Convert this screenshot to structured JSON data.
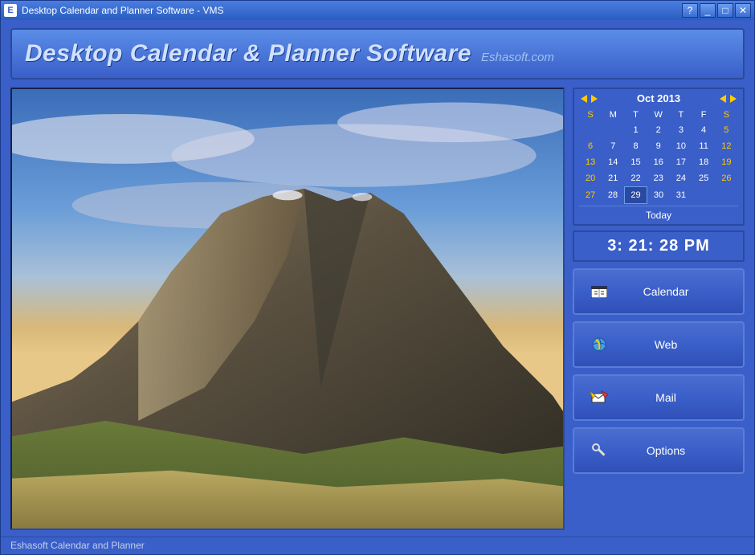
{
  "window": {
    "title": "Desktop Calendar and Planner Software - VMS",
    "appInitial": "E"
  },
  "banner": {
    "main": "Desktop Calendar & Planner Software",
    "sub": "Eshasoft.com"
  },
  "calendar": {
    "title": "Oct 2013",
    "dayHeaders": [
      "S",
      "M",
      "T",
      "W",
      "T",
      "F",
      "S"
    ],
    "weeks": [
      [
        "",
        "",
        "1",
        "2",
        "3",
        "4",
        "5"
      ],
      [
        "6",
        "7",
        "8",
        "9",
        "10",
        "11",
        "12"
      ],
      [
        "13",
        "14",
        "15",
        "16",
        "17",
        "18",
        "19"
      ],
      [
        "20",
        "21",
        "22",
        "23",
        "24",
        "25",
        "26"
      ],
      [
        "27",
        "28",
        "29",
        "30",
        "31",
        "",
        ""
      ]
    ],
    "selectedDay": "29",
    "todayLabel": "Today"
  },
  "clock": {
    "time": "3: 21: 28 PM"
  },
  "nav": {
    "calendar": "Calendar",
    "web": "Web",
    "mail": "Mail",
    "options": "Options"
  },
  "status": {
    "text": "Eshasoft Calendar and Planner"
  }
}
